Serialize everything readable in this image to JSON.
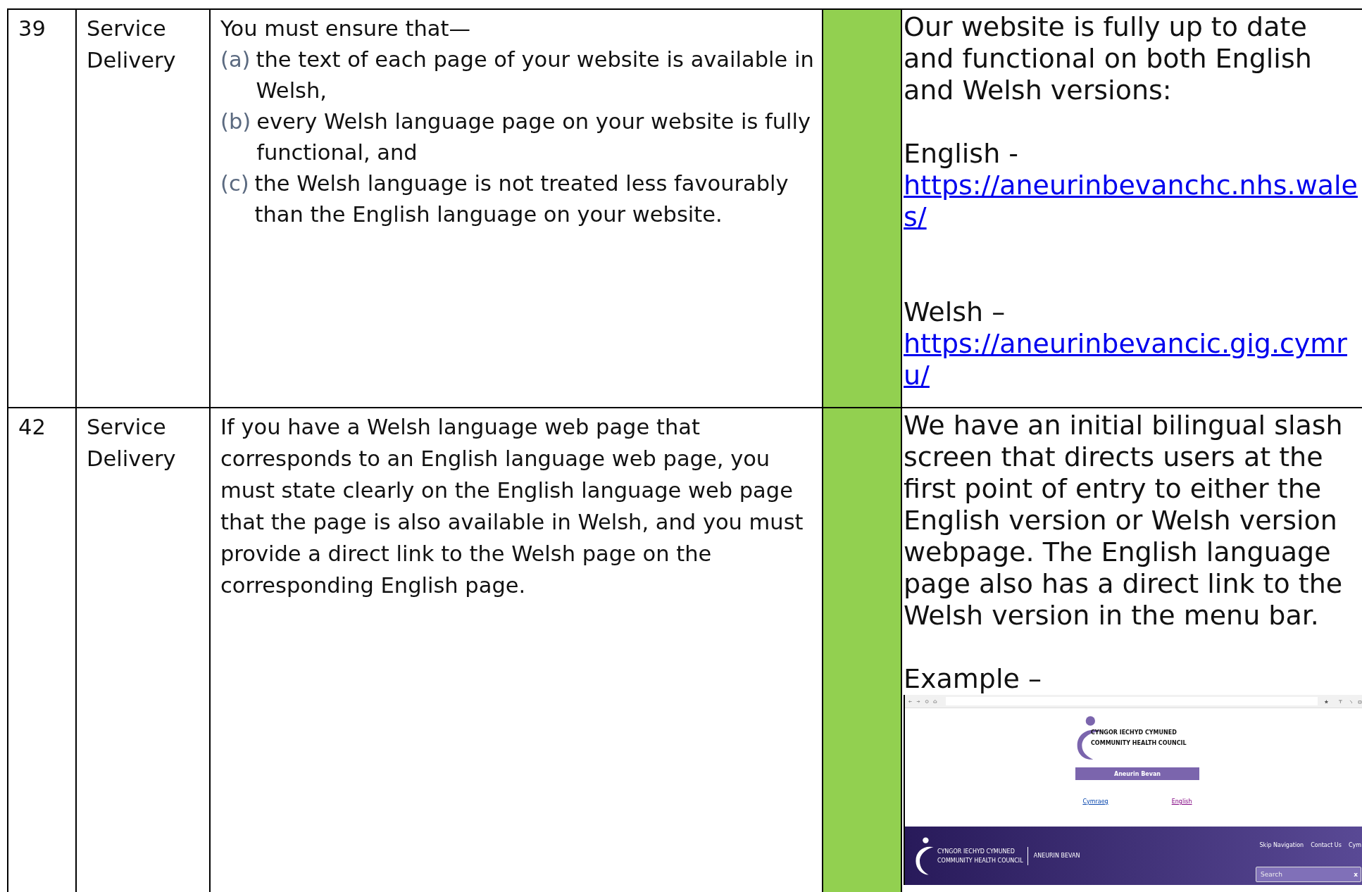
{
  "rows": [
    {
      "number": "39",
      "area": "Service Delivery",
      "requirement": [
        {
          "kind": "text",
          "text": "You must ensure that—"
        },
        {
          "kind": "item",
          "marker": "(a)",
          "text": "the text of each page of your website is available in Welsh,"
        },
        {
          "kind": "item",
          "marker": "(b)",
          "text": "every Welsh language page on your website is fully functional, and"
        },
        {
          "kind": "item",
          "marker": "(c)",
          "text": "the Welsh language is not treated less favourably than the English language on your website."
        }
      ],
      "response": [
        {
          "kind": "text",
          "text": "Our website is fully up to date and functional on both English and Welsh versions:"
        },
        {
          "kind": "text",
          "text": "English -"
        },
        {
          "kind": "link",
          "text": "https://aneurinbevanchc.nhs.wales/"
        },
        {
          "kind": "text",
          "text": "Welsh –"
        },
        {
          "kind": "link",
          "text": "https://aneurinbevancic.gig.cymru/"
        }
      ]
    },
    {
      "number": "42",
      "area": "Service Delivery",
      "requirement": [
        {
          "kind": "text",
          "text": "If you have a Welsh language web page that corresponds to an English language web page, you must state clearly on the English language web page that the page is also available in Welsh, and you must provide a direct link to the Welsh page on the corresponding English page."
        }
      ],
      "response": [
        {
          "kind": "text",
          "text": "We have an initial bilingual slash screen that directs users at the first point of entry to either the English version or Welsh version webpage. The English language page also has a direct link to the Welsh version in the menu bar."
        },
        {
          "kind": "text",
          "text": "Example –"
        },
        {
          "kind": "screenshot",
          "logo_lines": [
            "CYNGOR IECHYD CYMUNED",
            "COMMUNITY HEALTH COUNCIL"
          ],
          "button": "Aneurin Bevan",
          "language_links": [
            "Cymraeg",
            "English"
          ],
          "header_logo_lines": [
            "CYNGOR IECHYD CYMUNED",
            "COMMUNITY HEALTH COUNCIL"
          ],
          "header_region": "ANEURIN BEVAN",
          "nav_links": [
            "Skip Navigation",
            "Contact Us",
            "Cym"
          ],
          "search_placeholder": "Search",
          "search_clear": "x"
        }
      ]
    }
  ]
}
